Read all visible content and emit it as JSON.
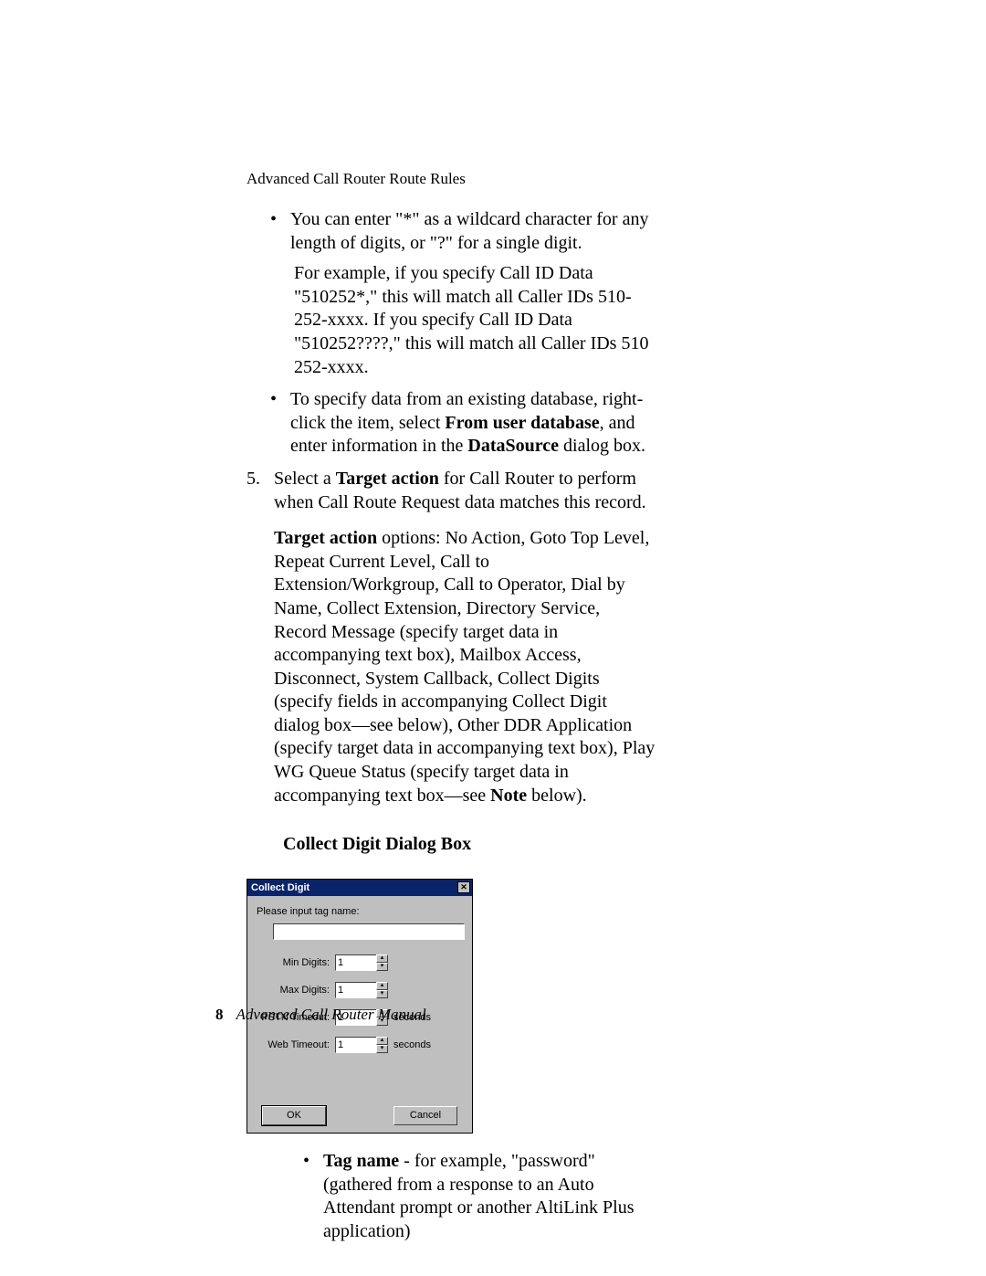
{
  "header": {
    "running_head": "Advanced Call Router Route Rules"
  },
  "body": {
    "bullet1_a": "You can enter \"*\" as a wildcard character for any length of digits, or \"?\" for a single digit.",
    "bullet1_b": "For example, if you specify Call ID Data \"510252*,\" this will match all Caller IDs 510-252-xxxx. If you specify Call ID Data \"510252????,\" this will match all Caller IDs 510 252-xxxx.",
    "bullet2_pre": "To specify data from an existing database, right-click the item, select ",
    "bullet2_b1": "From user database",
    "bullet2_mid": ", and enter information in the ",
    "bullet2_b2": "DataSource",
    "bullet2_post": " dialog box.",
    "step5_num": "5.",
    "step5_pre": "Select a ",
    "step5_b": "Target action",
    "step5_post": " for Call Router to perform when Call Route Request data matches this record.",
    "targetaction_b": "Target action",
    "targetaction_mid": " options: No Action, Goto Top Level, Repeat Current Level, Call to Extension/Workgroup, Call to Operator, Dial by Name, Collect Extension, Directory Service, Record Message (specify target data in accompanying text box), Mailbox Access, Disconnect, System Callback, Collect Digits (specify fields in accompanying Collect Digit dialog box—see below), Other DDR Application (specify target data in accompanying text box), Play WG Queue Status (specify target data in accompanying text box—see ",
    "targetaction_noteb": "Note",
    "targetaction_post": " below).",
    "heading_collect": "Collect Digit Dialog Box",
    "tagname_b": "Tag name",
    "tagname_rest": " - for example, \"password\" (gathered from a response to an Auto Attendant prompt or another AltiLink Plus application)"
  },
  "dialog": {
    "title": "Collect Digit",
    "close_glyph": "✕",
    "prompt": "Please input tag name:",
    "rows": {
      "min": {
        "label": "Min Digits:",
        "value": "1",
        "unit": ""
      },
      "max": {
        "label": "Max Digits:",
        "value": "1",
        "unit": ""
      },
      "pstn": {
        "label": "PSTN Timeout:",
        "value": "1",
        "unit": "seconds"
      },
      "web": {
        "label": "Web Timeout:",
        "value": "1",
        "unit": "seconds"
      }
    },
    "ok": "OK",
    "cancel": "Cancel",
    "up_glyph": "▴",
    "down_glyph": "▾"
  },
  "footer": {
    "page_number": "8",
    "title": "Advanced Call Router Manual"
  }
}
